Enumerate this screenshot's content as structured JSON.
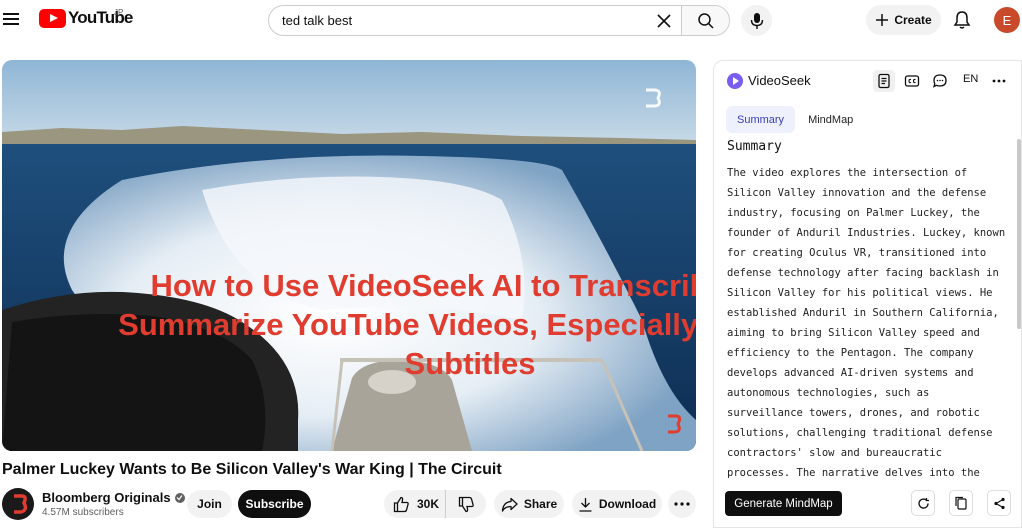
{
  "header": {
    "logo_text": "YouTube",
    "region": "JP",
    "search_value": "ted talk best",
    "create_label": "Create",
    "avatar_initial": "E"
  },
  "video": {
    "overlay_lines": [
      "How to Use VideoSeek AI to Transcribe and",
      "Summarize YouTube Videos, Especially Without",
      "Subtitles"
    ],
    "title": "Palmer Luckey Wants to Be Silicon Valley's War King | The Circuit"
  },
  "channel": {
    "name": "Bloomberg Originals",
    "subscribers": "4.57M subscribers",
    "join_label": "Join",
    "subscribe_label": "Subscribe"
  },
  "actions": {
    "likes": "30K",
    "share_label": "Share",
    "download_label": "Download"
  },
  "panel": {
    "app_name": "VideoSeek",
    "language": "EN",
    "tabs": [
      "Summary",
      "MindMap"
    ],
    "summary_heading": "Summary",
    "summary_text": "The video explores the intersection of Silicon Valley innovation and the defense industry, focusing on Palmer Luckey, the founder of Anduril Industries. Luckey, known for creating Oculus VR, transitioned into defense technology after facing backlash in Silicon Valley for his political views. He established Anduril in Southern California, aiming to bring Silicon Valley speed and efficiency to the Pentagon. The company develops advanced AI-driven systems and autonomous technologies, such as surveillance towers, drones, and robotic solutions, challenging traditional defense contractors' slow and bureaucratic processes. The narrative delves into the challenges of integrating cutting-edge tech into military",
    "generate_label": "Generate MindMap"
  },
  "colors": {
    "overlay_text": "#e03c2f",
    "youtube_red": "#ff0000",
    "videoseek_accent": "#7b5cf0",
    "active_tab_text": "#3b3fb6"
  }
}
